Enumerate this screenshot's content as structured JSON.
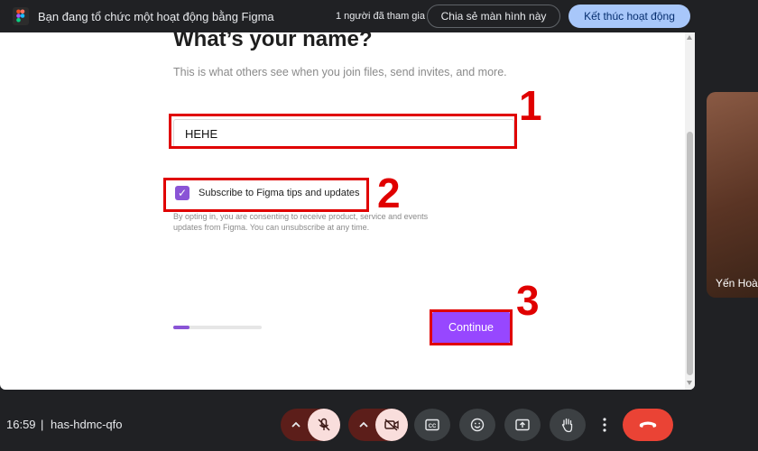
{
  "topbar": {
    "title": "Bạn đang tổ chức một hoạt động bằng Figma",
    "participants": "1 người đã tham gia",
    "share_label": "Chia sẻ màn hình này",
    "end_label": "Kết thúc hoạt động"
  },
  "form": {
    "heading": "What’s your name?",
    "subtitle": "This is what others see when you join files, send invites, and more.",
    "name_value": "HEHE",
    "checkbox_checked": true,
    "checkbox_label": "Subscribe to Figma tips and updates",
    "disclaimer": "By opting in, you are consenting to receive product, service and events updates from Figma. You can unsubscribe at any time.",
    "progress_percent": 18,
    "continue_label": "Continue"
  },
  "annotations": [
    "1",
    "2",
    "3"
  ],
  "participant_tile": {
    "name": "Yến Hoà"
  },
  "bottom": {
    "time": "16:59",
    "separator": "|",
    "meeting_code": "has-hdmc-qfo"
  },
  "icons": {
    "app": "figma-icon",
    "mic": "mic-off-icon",
    "cam": "camera-off-icon",
    "captions": "captions-icon",
    "emoji": "emoji-icon",
    "present": "present-screen-icon",
    "hand": "raise-hand-icon",
    "more": "more-vert-icon",
    "leave": "call-end-icon"
  },
  "colors": {
    "accent": "#9747ff",
    "highlight": "#e00000",
    "leave": "#ea4335",
    "end_activity": "#a8c7fa"
  }
}
